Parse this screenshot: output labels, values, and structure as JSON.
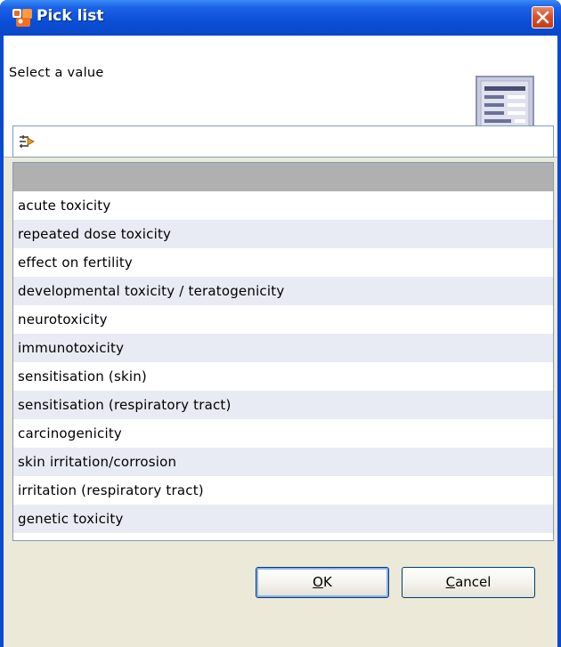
{
  "window": {
    "title": "Pick list",
    "app_icon": "app-logo-icon",
    "close_icon": "close-icon"
  },
  "header": {
    "prompt": "Select a value",
    "icon": "document-list-icon"
  },
  "filter": {
    "icon": "filter-options-icon"
  },
  "list": {
    "items": [
      "",
      "acute toxicity",
      "repeated dose toxicity",
      "effect on fertility",
      "developmental toxicity / teratogenicity",
      "neurotoxicity",
      "immunotoxicity",
      "sensitisation (skin)",
      "sensitisation (respiratory tract)",
      "carcinogenicity",
      "skin irritation/corrosion",
      "irritation (respiratory tract)",
      "genetic toxicity"
    ],
    "selected_index": 0
  },
  "buttons": {
    "ok_mnemonic": "O",
    "ok_rest": "K",
    "cancel_mnemonic": "C",
    "cancel_rest": "ancel"
  },
  "colors": {
    "titlebar": "#0a4fd6",
    "selected_row": "#b0b0b0",
    "alt_row": "#e8ebf3",
    "dialog_bg": "#ece9d8"
  }
}
